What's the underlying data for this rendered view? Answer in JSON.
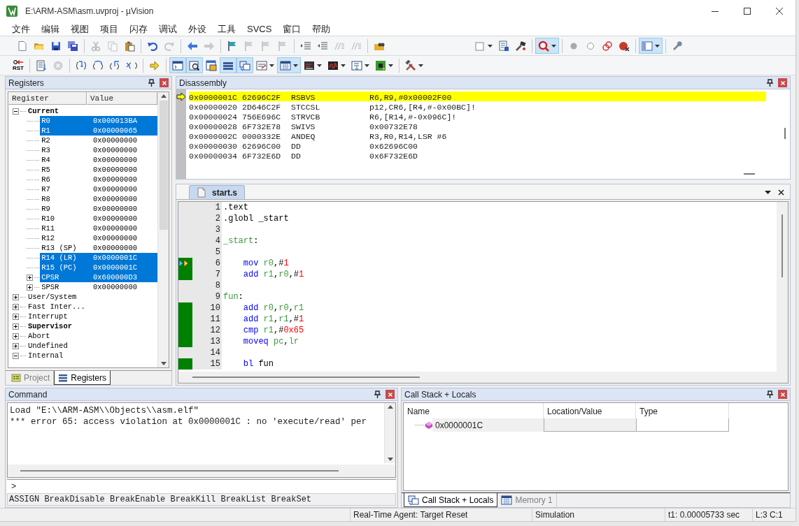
{
  "window": {
    "title": "E:\\ARM-ASM\\asm.uvproj - µVision"
  },
  "menu": [
    "文件",
    "编辑",
    "视图",
    "项目",
    "闪存",
    "调试",
    "外设",
    "工具",
    "SVCS",
    "窗口",
    "帮助"
  ],
  "toolbar_1": [
    {
      "on": false,
      "disabled": false
    },
    {
      "on": false,
      "disabled": false
    },
    {
      "on": false,
      "disabled": false
    },
    {
      "on": false,
      "disabled": false
    },
    {
      "on": false,
      "disabled": true
    },
    {
      "on": false,
      "disabled": true
    },
    {
      "on": false,
      "disabled": false
    },
    {
      "on": false,
      "disabled": false
    },
    {
      "on": false,
      "disabled": true
    },
    {
      "on": false,
      "disabled": false
    },
    {
      "on": false,
      "disabled": true
    },
    {
      "on": false,
      "disabled": false
    },
    {
      "on": false,
      "disabled": true
    },
    {
      "on": false,
      "disabled": true
    },
    {
      "on": false,
      "disabled": true
    },
    {
      "on": false,
      "disabled": false
    },
    {
      "on": false,
      "disabled": false
    },
    {
      "on": false,
      "disabled": true
    },
    {
      "on": false,
      "disabled": true
    },
    {
      "on": false,
      "disabled": false
    },
    {
      "on": false,
      "disabled": false
    },
    {
      "on": false,
      "disabled": false
    },
    {
      "on": false,
      "disabled": false
    },
    {
      "on": true,
      "disabled": false
    },
    {
      "on": false,
      "disabled": false
    },
    {
      "on": false,
      "disabled": false
    },
    {
      "on": false,
      "disabled": false
    },
    {
      "on": false,
      "disabled": false
    },
    {
      "on": true,
      "disabled": false
    },
    {
      "on": false,
      "disabled": false
    }
  ],
  "toolbar_2": [
    {
      "label": "RST",
      "on": false,
      "disabled": false
    },
    {
      "on": false,
      "disabled": false
    },
    {
      "on": false,
      "disabled": true
    },
    {
      "on": false,
      "disabled": false
    },
    {
      "on": false,
      "disabled": false
    },
    {
      "on": false,
      "disabled": false
    },
    {
      "on": false,
      "disabled": false
    },
    {
      "on": false,
      "disabled": false
    },
    {
      "on": true,
      "disabled": false
    },
    {
      "on": true,
      "disabled": false
    },
    {
      "on": false,
      "disabled": false
    },
    {
      "on": true,
      "disabled": false
    },
    {
      "on": true,
      "disabled": false
    },
    {
      "on": false,
      "disabled": false
    },
    {
      "on": true,
      "disabled": false
    },
    {
      "on": false,
      "disabled": false
    },
    {
      "on": false,
      "disabled": false
    },
    {
      "on": false,
      "disabled": false
    },
    {
      "on": false,
      "disabled": false
    },
    {
      "on": false,
      "disabled": false
    }
  ],
  "registers_panel": {
    "title": "Registers",
    "columns": [
      "Register",
      "Value"
    ],
    "tree": [
      {
        "name": "Current",
        "bold": true,
        "expanded": true,
        "selected": false,
        "children": [
          {
            "name": "R0",
            "value": "0x000013BA",
            "selected": true
          },
          {
            "name": "R1",
            "value": "0x00000065",
            "selected": true
          },
          {
            "name": "R2",
            "value": "0x00000000",
            "selected": false
          },
          {
            "name": "R3",
            "value": "0x00000000",
            "selected": false
          },
          {
            "name": "R4",
            "value": "0x00000000",
            "selected": false
          },
          {
            "name": "R5",
            "value": "0x00000000",
            "selected": false
          },
          {
            "name": "R6",
            "value": "0x00000000",
            "selected": false
          },
          {
            "name": "R7",
            "value": "0x00000000",
            "selected": false
          },
          {
            "name": "R8",
            "value": "0x00000000",
            "selected": false
          },
          {
            "name": "R9",
            "value": "0x00000000",
            "selected": false
          },
          {
            "name": "R10",
            "value": "0x00000000",
            "selected": false
          },
          {
            "name": "R11",
            "value": "0x00000000",
            "selected": false
          },
          {
            "name": "R12",
            "value": "0x00000000",
            "selected": false
          },
          {
            "name": "R13 (SP)",
            "value": "0x00000000",
            "selected": false
          },
          {
            "name": "R14 (LR)",
            "value": "0x0000001C",
            "selected": true
          },
          {
            "name": "R15 (PC)",
            "value": "0x0000001C",
            "selected": true
          },
          {
            "name": "CPSR",
            "value": "0x600000D3",
            "selected": true,
            "expanded": false
          },
          {
            "name": "SPSR",
            "value": "0x00000000",
            "selected": false,
            "expanded": false
          }
        ]
      },
      {
        "name": "User/System",
        "bold": false,
        "expanded": false,
        "selected": false
      },
      {
        "name": "Fast Inter...",
        "bold": false,
        "expanded": false,
        "selected": false
      },
      {
        "name": "Interrupt",
        "bold": false,
        "expanded": false,
        "selected": false
      },
      {
        "name": "Supervisor",
        "bold": true,
        "expanded": false,
        "selected": false
      },
      {
        "name": "Abort",
        "bold": false,
        "expanded": false,
        "selected": false
      },
      {
        "name": "Undefined",
        "bold": false,
        "expanded": false,
        "selected": false
      },
      {
        "name": "Internal",
        "bold": false,
        "expanded": true,
        "selected": false
      }
    ],
    "tabs": [
      {
        "label": "Project",
        "selected": false
      },
      {
        "label": "Registers",
        "selected": true
      }
    ]
  },
  "disassembly": {
    "title": "Disassembly",
    "rows": [
      {
        "address": "0x0000001C",
        "opcode": "62696C2F",
        "mnemonic": "RSBVS",
        "operands": "R6,R9,#0x00002F00",
        "current": true
      },
      {
        "address": "0x00000020",
        "opcode": "2D646C2F",
        "mnemonic": "STCCSL",
        "operands": "p12,CR6,[R4,#-0x00BC]!",
        "current": false
      },
      {
        "address": "0x00000024",
        "opcode": "756E696C",
        "mnemonic": "STRVCB",
        "operands": "R6,[R14,#-0x096C]!",
        "current": false
      },
      {
        "address": "0x00000028",
        "opcode": "6F732E78",
        "mnemonic": "SWIVS",
        "operands": "0x00732E78",
        "current": false
      },
      {
        "address": "0x0000002C",
        "opcode": "0000332E",
        "mnemonic": "ANDEQ",
        "operands": "R3,R0,R14,LSR #6",
        "current": false
      },
      {
        "address": "0x00000030",
        "opcode": "62696C00",
        "mnemonic": "DD",
        "operands": "0x62696C00",
        "current": false
      },
      {
        "address": "0x00000034",
        "opcode": "6F732E6D",
        "mnemonic": "DD",
        "operands": "0x6F732E6D",
        "current": false
      }
    ]
  },
  "editor": {
    "tabs": [
      {
        "label": "start.s",
        "selected": true
      }
    ],
    "lines": [
      {
        "number": "1",
        "covered": false,
        "current": false,
        "tokens": [
          {
            "text": ".text",
            "kind": "plain"
          }
        ]
      },
      {
        "number": "2",
        "covered": false,
        "current": false,
        "tokens": [
          {
            "text": ".globl _start",
            "kind": "plain"
          }
        ]
      },
      {
        "number": "3",
        "covered": false,
        "current": false
      },
      {
        "number": "4",
        "covered": false,
        "current": false,
        "tokens": [
          {
            "text": "_start",
            "kind": "label"
          },
          {
            "text": ":",
            "kind": "plain"
          }
        ]
      },
      {
        "number": "5",
        "covered": false,
        "current": false
      },
      {
        "number": "6",
        "covered": true,
        "current": true,
        "tokens": [
          {
            "text": "    mov ",
            "kind": "keyword"
          },
          {
            "text": "r0",
            "kind": "register"
          },
          {
            "text": ",#",
            "kind": "plain"
          },
          {
            "text": "1",
            "kind": "number"
          }
        ]
      },
      {
        "number": "7",
        "covered": true,
        "current": false,
        "tokens": [
          {
            "text": "    add ",
            "kind": "keyword"
          },
          {
            "text": "r1",
            "kind": "register"
          },
          {
            "text": ",",
            "kind": "plain"
          },
          {
            "text": "r0",
            "kind": "register"
          },
          {
            "text": ",#",
            "kind": "plain"
          },
          {
            "text": "1",
            "kind": "number"
          }
        ]
      },
      {
        "number": "8",
        "covered": false,
        "current": false
      },
      {
        "number": "9",
        "covered": false,
        "current": false,
        "tokens": [
          {
            "text": "fun",
            "kind": "label"
          },
          {
            "text": ":",
            "kind": "plain"
          }
        ]
      },
      {
        "number": "10",
        "covered": true,
        "current": false,
        "tokens": [
          {
            "text": "    add ",
            "kind": "keyword"
          },
          {
            "text": "r0",
            "kind": "register"
          },
          {
            "text": ",",
            "kind": "plain"
          },
          {
            "text": "r0",
            "kind": "register"
          },
          {
            "text": ",",
            "kind": "plain"
          },
          {
            "text": "r1",
            "kind": "register"
          }
        ]
      },
      {
        "number": "11",
        "covered": true,
        "current": false,
        "tokens": [
          {
            "text": "    add ",
            "kind": "keyword"
          },
          {
            "text": "r1",
            "kind": "register"
          },
          {
            "text": ",",
            "kind": "plain"
          },
          {
            "text": "r1",
            "kind": "register"
          },
          {
            "text": ",#",
            "kind": "plain"
          },
          {
            "text": "1",
            "kind": "number"
          }
        ]
      },
      {
        "number": "12",
        "covered": true,
        "current": false,
        "tokens": [
          {
            "text": "    cmp ",
            "kind": "keyword"
          },
          {
            "text": "r1",
            "kind": "register"
          },
          {
            "text": ",#",
            "kind": "plain"
          },
          {
            "text": "0x65",
            "kind": "number"
          }
        ]
      },
      {
        "number": "13",
        "covered": true,
        "current": false,
        "tokens": [
          {
            "text": "    moveq ",
            "kind": "keyword"
          },
          {
            "text": "pc",
            "kind": "register"
          },
          {
            "text": ",",
            "kind": "plain"
          },
          {
            "text": "lr",
            "kind": "register"
          }
        ]
      },
      {
        "number": "14",
        "covered": false,
        "current": false
      },
      {
        "number": "15",
        "covered": true,
        "current": false,
        "tokens": [
          {
            "text": "    bl ",
            "kind": "keyword"
          },
          {
            "text": "fun",
            "kind": "plain"
          }
        ]
      }
    ]
  },
  "command": {
    "title": "Command",
    "output": [
      "Load \"E:\\\\ARM-ASM\\\\Objects\\\\asm.elf\"",
      "*** error 65: access violation at 0x0000001C : no 'execute/read' per"
    ],
    "prompt": ">",
    "hint": "ASSIGN BreakDisable BreakEnable BreakKill BreakList BreakSet"
  },
  "call_stack": {
    "title": "Call Stack + Locals",
    "columns": [
      "Name",
      "Location/Value",
      "Type"
    ],
    "rows": [
      {
        "name": "0x0000001C"
      }
    ],
    "tabs": [
      {
        "label": "Call Stack + Locals",
        "selected": true
      },
      {
        "label": "Memory 1",
        "selected": false
      }
    ]
  },
  "status_bar": [
    "Real-Time Agent: Target Reset",
    "Simulation",
    "t1: 0.00005733 sec",
    "L:3 C:1"
  ]
}
